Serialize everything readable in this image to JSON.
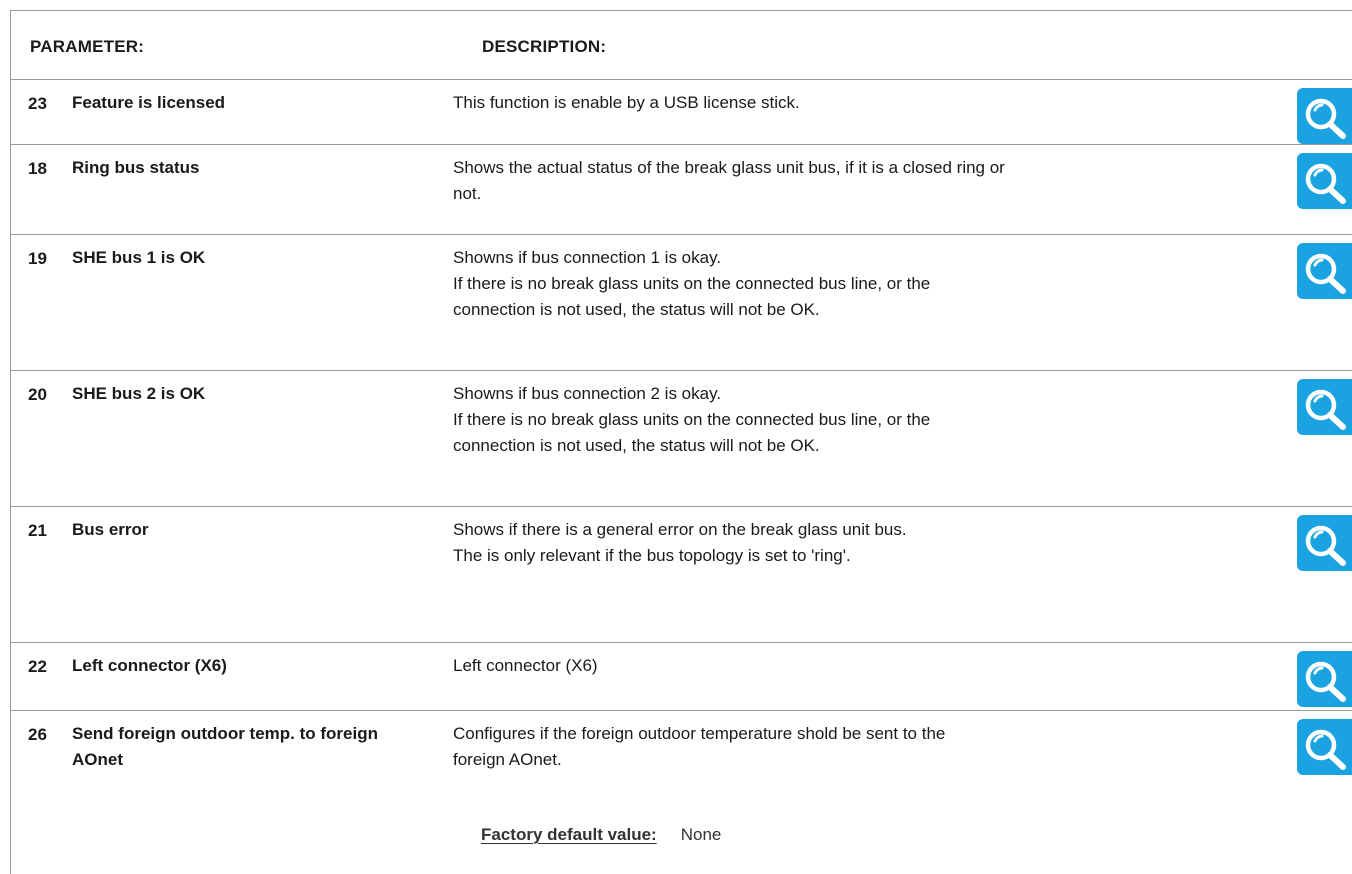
{
  "header": {
    "parameter_label": "PARAMETER:",
    "description_label": "DESCRIPTION:"
  },
  "rows": [
    {
      "number": "23",
      "name": "Feature is licensed",
      "description": [
        "This function is enable by a USB license stick."
      ]
    },
    {
      "number": "18",
      "name": "Ring bus status",
      "description": [
        "Shows the actual status of the break glass unit bus, if it is a closed ring or",
        "not."
      ]
    },
    {
      "number": "19",
      "name": "SHE bus 1 is OK",
      "description": [
        "Showns if bus connection 1 is okay.",
        "If there is no break glass units on the connected bus line, or the",
        "connection is not used, the status will not be OK."
      ]
    },
    {
      "number": "20",
      "name": "SHE bus 2 is OK",
      "description": [
        "Showns if bus connection 2 is okay.",
        "If there is no break glass units on the connected bus line, or the",
        "connection is not used, the status will not be OK."
      ]
    },
    {
      "number": "21",
      "name": "Bus error",
      "description": [
        "Shows if there is a general error on the break glass unit bus.",
        "The is only relevant if the bus topology is set to 'ring'."
      ]
    },
    {
      "number": "22",
      "name": "Left connector (X6)",
      "description": [
        "Left connector (X6)"
      ]
    },
    {
      "number": "26",
      "name": "Send foreign outdoor temp. to foreign AOnet",
      "description": [
        "Configures if the foreign outdoor temperature shold be sent to the",
        "foreign AOnet."
      ],
      "factory_default_label": "Factory default value:",
      "factory_default_value": "None"
    }
  ],
  "icons": {
    "row_action": "search-icon"
  },
  "colors": {
    "search_button": "#1aa3e0",
    "divider": "#9a9a9a",
    "text": "#1a1a1a"
  }
}
